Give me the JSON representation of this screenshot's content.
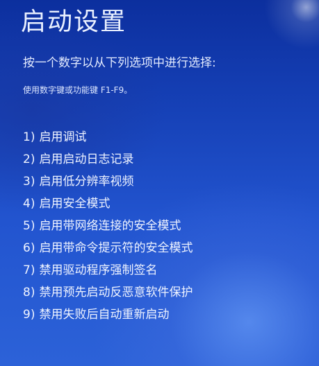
{
  "screen": {
    "title": "启动设置",
    "prompt": "按一个数字以从下列选项中进行选择:",
    "hint": "使用数字键或功能键 F1-F9。",
    "options": [
      {
        "number": "1)",
        "label": "启用调试"
      },
      {
        "number": "2)",
        "label": "启用启动日志记录"
      },
      {
        "number": "3)",
        "label": "启用低分辨率视频"
      },
      {
        "number": "4)",
        "label": "启用安全模式"
      },
      {
        "number": "5)",
        "label": "启用带网络连接的安全模式"
      },
      {
        "number": "6)",
        "label": "启用带命令提示符的安全模式"
      },
      {
        "number": "7)",
        "label": "禁用驱动程序强制签名"
      },
      {
        "number": "8)",
        "label": "禁用预先启动反恶意软件保护"
      },
      {
        "number": "9)",
        "label": "禁用失败后自动重新启动"
      }
    ]
  },
  "colors": {
    "background_top": "#0c2f9e",
    "background_bottom": "#2c62d8",
    "text": "#ffffff"
  }
}
